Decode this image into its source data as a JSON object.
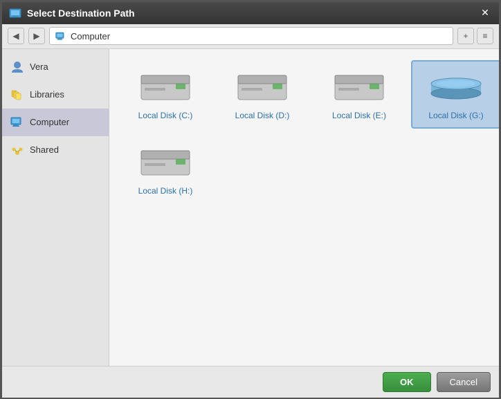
{
  "dialog": {
    "title": "Select Destination Path",
    "close_label": "✕"
  },
  "toolbar": {
    "back_label": "◀",
    "forward_label": "▶",
    "add_label": "+",
    "view_label": "≡",
    "breadcrumb": {
      "text": "Computer",
      "icon": "computer"
    }
  },
  "sidebar": {
    "items": [
      {
        "id": "vera",
        "label": "Vera",
        "icon": "user"
      },
      {
        "id": "libraries",
        "label": "Libraries",
        "icon": "libraries"
      },
      {
        "id": "computer",
        "label": "Computer",
        "icon": "computer",
        "active": true
      },
      {
        "id": "shared",
        "label": "Shared",
        "icon": "shared"
      }
    ]
  },
  "content": {
    "disks": [
      {
        "id": "c",
        "label": "Local Disk (C:)",
        "selected": false
      },
      {
        "id": "d",
        "label": "Local Disk (D:)",
        "selected": false
      },
      {
        "id": "e",
        "label": "Local Disk (E:)",
        "selected": false
      },
      {
        "id": "g",
        "label": "Local Disk (G:)",
        "selected": true
      },
      {
        "id": "h",
        "label": "Local Disk (H:)",
        "selected": false
      }
    ]
  },
  "footer": {
    "ok_label": "OK",
    "cancel_label": "Cancel"
  }
}
